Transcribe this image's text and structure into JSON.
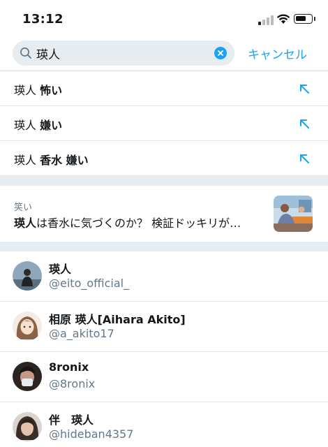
{
  "status_bar": {
    "time": "13:12"
  },
  "search": {
    "query": "瑛人",
    "cancel_label": "キャンセル"
  },
  "suggestions": [
    {
      "prefix": "瑛人",
      "suffix": "怖い"
    },
    {
      "prefix": "瑛人",
      "suffix": "嫌い"
    },
    {
      "prefix": "瑛人",
      "suffix": "香水 嫌い"
    }
  ],
  "trend": {
    "category": "笑い",
    "title_bold": "瑛人",
    "title_rest": "は香水に気づくのか？ 検証ドッキリが…"
  },
  "users": [
    {
      "name": "瑛人",
      "handle": "@eito_official_"
    },
    {
      "name": "相原 瑛人[Aihara Akito]",
      "handle": "@a_akito17"
    },
    {
      "name": "8ronix",
      "handle": "@8ronix"
    },
    {
      "name": "伴　瑛人",
      "handle": "@hideban4357"
    }
  ],
  "colors": {
    "accent": "#1da1f2",
    "secondary_text": "#657786",
    "separator": "#e6ecf0"
  }
}
